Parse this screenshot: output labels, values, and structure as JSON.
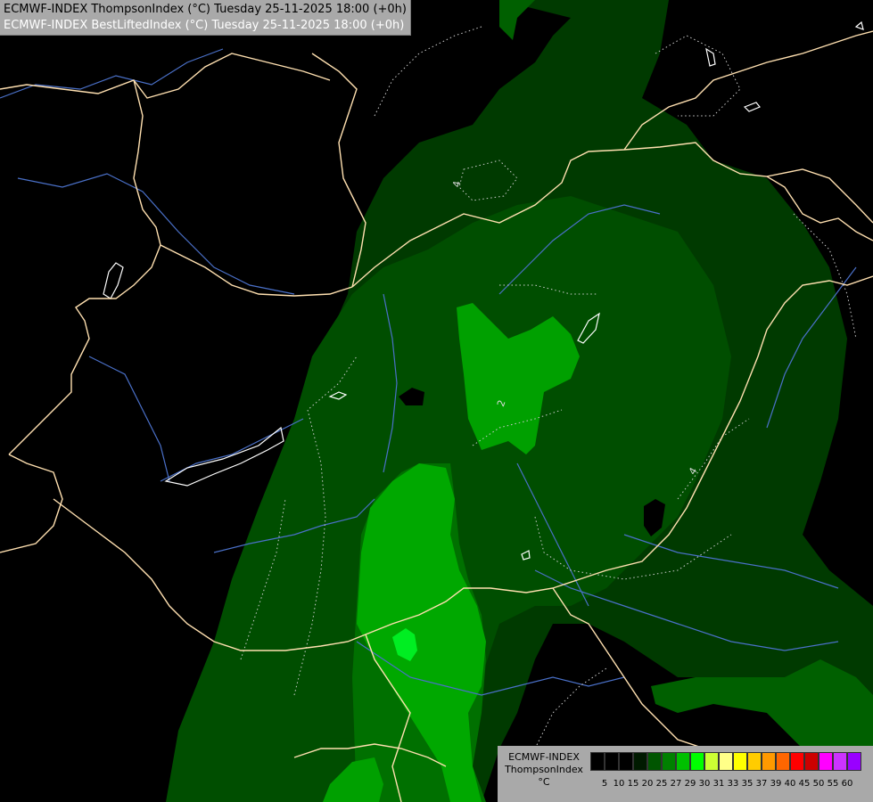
{
  "header": {
    "line1": "ECMWF-INDEX ThompsonIndex (°C) Tuesday 25-11-2025 18:00 (+0h)",
    "line2": "ECMWF-INDEX BestLiftedIndex (°C) Tuesday 25-11-2025 18:00 (+0h)"
  },
  "legend": {
    "line1": "ECMWF-INDEX",
    "line2": "ThompsonIndex",
    "line3": "°C",
    "swatch_colors": [
      "#000000",
      "#000000",
      "#000000",
      "#001a00",
      "#005500",
      "#008000",
      "#00c000",
      "#00ff00",
      "#ccff33",
      "#ffff88",
      "#ffff00",
      "#ffcc00",
      "#ff9900",
      "#ff6600",
      "#ff0000",
      "#cc0000",
      "#ff00ff",
      "#cc33ff",
      "#9900ff",
      "#6600ff",
      "#0000ff"
    ],
    "ticks": [
      "5",
      "10",
      "15",
      "20",
      "25",
      "27",
      "29",
      "30",
      "31",
      "33",
      "35",
      "37",
      "39",
      "40",
      "45",
      "50",
      "55",
      "60"
    ]
  },
  "contour_labels": [
    "4",
    "2",
    "4"
  ],
  "colors": {
    "dark_green": "#003300",
    "mid_green": "#006600",
    "green": "#008800",
    "bright_green": "#00bb00",
    "lime": "#00ff33",
    "border": "#ffe0b0",
    "river": "#4a70c8"
  }
}
